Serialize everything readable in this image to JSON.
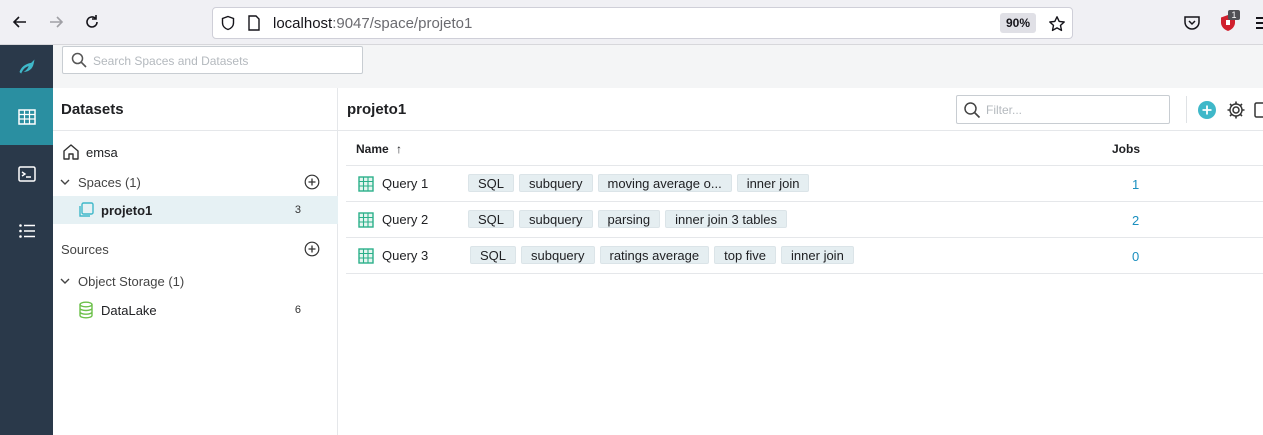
{
  "browser": {
    "url_host": "localhost",
    "url_rest": ":9047/space/projeto1",
    "zoom": "90%",
    "extension_badge": "1"
  },
  "search": {
    "placeholder": "Search Spaces and Datasets"
  },
  "sidebar": {
    "title": "Datasets",
    "home": "emsa",
    "spaces_label": "Spaces (1)",
    "spaces": [
      {
        "label": "projeto1",
        "count": "3"
      }
    ],
    "sources_label": "Sources",
    "object_storage_label": "Object Storage (1)",
    "sources": [
      {
        "label": "DataLake",
        "count": "6"
      }
    ]
  },
  "main": {
    "title": "projeto1",
    "filter_placeholder": "Filter...",
    "columns": {
      "name": "Name",
      "sort_icon": "↑",
      "jobs": "Jobs"
    },
    "rows": [
      {
        "name": "Query 1",
        "tags": [
          "SQL",
          "subquery",
          "moving average o...",
          "inner join"
        ],
        "jobs": "1"
      },
      {
        "name": "Query 2",
        "tags": [
          "SQL",
          "subquery",
          "parsing",
          "inner join 3 tables"
        ],
        "jobs": "2"
      },
      {
        "name": "Query 3",
        "tags": [
          "SQL",
          "subquery",
          "ratings average",
          "top five",
          "inner join"
        ],
        "jobs": "0"
      }
    ]
  },
  "colors": {
    "nav_bg": "#2a394a",
    "nav_active": "#2a8fa1",
    "accent": "#3fb8c9",
    "link": "#1a8fbf",
    "tag_bg": "#e5eef1",
    "selected_row": "#e6f1f4"
  }
}
